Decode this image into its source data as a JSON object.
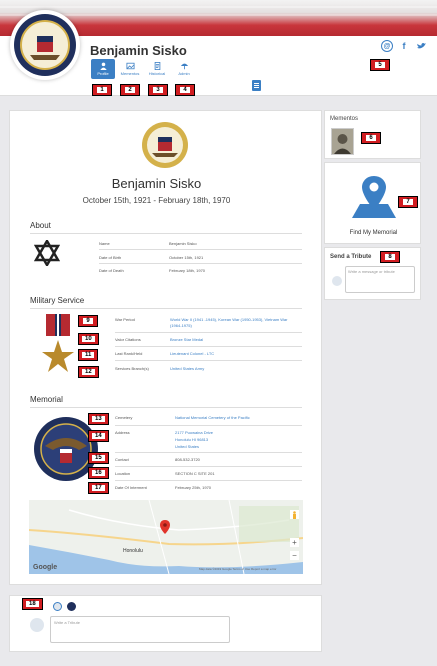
{
  "app": {
    "person_name": "Benjamin Sisko"
  },
  "tabs": [
    {
      "label": "Profile",
      "icon": "person-icon",
      "active": true
    },
    {
      "label": "Mementos",
      "icon": "photo-icon",
      "active": false
    },
    {
      "label": "Historical",
      "icon": "document-icon",
      "active": false
    },
    {
      "label": "Admin",
      "icon": "umbrella-icon",
      "active": false
    }
  ],
  "social": [
    {
      "label": "@",
      "icon": "at-icon"
    },
    {
      "label": "f",
      "icon": "facebook-icon"
    },
    {
      "label": "t",
      "icon": "twitter-icon"
    }
  ],
  "annotations": [
    "1",
    "2",
    "3",
    "4",
    "5",
    "6",
    "7",
    "8",
    "9",
    "10",
    "11",
    "12",
    "13",
    "14",
    "15",
    "16",
    "17",
    "18"
  ],
  "profile": {
    "name": "Benjamin Sisko",
    "dates": "October 15th, 1921 - February 18th, 1970"
  },
  "about": {
    "title": "About",
    "rows": [
      {
        "label": "Name",
        "value": "Benjamin Sisko"
      },
      {
        "label": "Date of Birth",
        "value": "October 15th, 1921"
      },
      {
        "label": "Date of Death",
        "value": "February 18th, 1970"
      }
    ]
  },
  "military": {
    "title": "Military Service",
    "rows": [
      {
        "label": "War Period",
        "value": "World War II (1941 -1945), Korean War (1950-1953), Vietnam War (1964-1975)",
        "link": true
      },
      {
        "label": "Valor Citations",
        "value": "Bronze Star Medal",
        "link": true
      },
      {
        "label": "Last Rank/Held",
        "value": "Lieutenant Colonel - LTC",
        "link": true
      },
      {
        "label": "Services Branch(s)",
        "value": "United States Army",
        "link": true
      }
    ]
  },
  "memorial": {
    "title": "Memorial",
    "rows": [
      {
        "label": "Cemetery",
        "value": "National Memorial Cemetery of the Pacific",
        "link": true
      },
      {
        "label": "Address",
        "value": "2177 Puowaina Drive",
        "link": true
      },
      {
        "label": "",
        "value": "Honolulu HI 96813",
        "link": true
      },
      {
        "label": "",
        "value": "United States",
        "link": true
      },
      {
        "label": "Contact",
        "value": "808-532-3720",
        "link": false
      },
      {
        "label": "Location",
        "value": "SECTION C SITE 201",
        "link": false
      },
      {
        "label": "Date Of Interment",
        "value": "February 25th, 1970",
        "link": false
      }
    ],
    "map": {
      "labels": [
        "Honolulu",
        "Google",
        "Map data ©2019 Google  Terms of Use  Report a map error"
      ],
      "zoom_in": "+",
      "zoom_out": "−"
    }
  },
  "sidebar": {
    "mementos_title": "Mementos",
    "find_label": "Find My Memorial",
    "tribute_title": "Send a Tribute",
    "tribute_placeholder": "Write a message or tribute"
  },
  "bottom": {
    "tribute_placeholder": "Write a Tribute"
  },
  "colors": {
    "accent": "#3b7fc4",
    "badge": "#d11d21",
    "banner_red": "#b52a31"
  }
}
